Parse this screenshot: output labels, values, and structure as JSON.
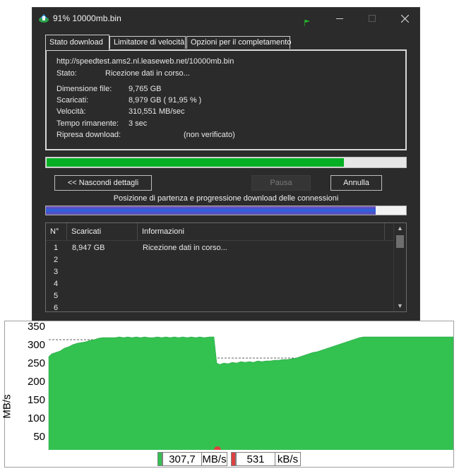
{
  "window": {
    "title": "91% 10000mb.bin"
  },
  "tabs": [
    {
      "label": "Stato download",
      "active": true
    },
    {
      "label": "Limitatore di velocità",
      "active": false
    },
    {
      "label": "Opzioni per il completamento",
      "active": false
    }
  ],
  "details": {
    "url": "http://speedtest.ams2.nl.leaseweb.net/10000mb.bin",
    "status_label": "Stato:",
    "status_value": "Ricezione dati in corso...",
    "size_label": "Dimensione file:",
    "size_value": "9,765  GB",
    "downloaded_label": "Scaricati:",
    "downloaded_value": "8,979  GB  ( 91,95 % )",
    "speed_label": "Velocità:",
    "speed_value": "310,551  MB/sec",
    "remaining_label": "Tempo rimanente:",
    "remaining_value": "3 sec",
    "resume_label": "Ripresa download:",
    "resume_value": "(non verificato)"
  },
  "progress": {
    "main_fraction": 0.9195,
    "connection_fraction": 0.92
  },
  "buttons": {
    "hide_details": "<< Nascondi dettagli",
    "pause": "Pausa",
    "cancel": "Annulla"
  },
  "connections": {
    "caption": "Posizione di partenza e progressione download delle connessioni",
    "headers": [
      "N°",
      "Scaricati",
      "Informazioni"
    ],
    "rows": [
      {
        "n": "1",
        "downloaded": "8,947  GB",
        "info": "Ricezione dati in corso..."
      },
      {
        "n": "2",
        "downloaded": "",
        "info": ""
      },
      {
        "n": "3",
        "downloaded": "",
        "info": ""
      },
      {
        "n": "4",
        "downloaded": "",
        "info": ""
      },
      {
        "n": "5",
        "downloaded": "",
        "info": ""
      },
      {
        "n": "6",
        "downloaded": "",
        "info": ""
      }
    ]
  },
  "graph": {
    "ylabel": "MB/s",
    "fill_color": "#33c150",
    "ticks": [
      "350",
      "300",
      "250",
      "200",
      "150",
      "100",
      "50"
    ]
  },
  "status_bar": {
    "download_speed": "307,7",
    "download_unit": "MB/s",
    "upload_speed": "531",
    "upload_unit": "kB/s",
    "download_color": "#33c150",
    "upload_color": "#e04040"
  }
}
